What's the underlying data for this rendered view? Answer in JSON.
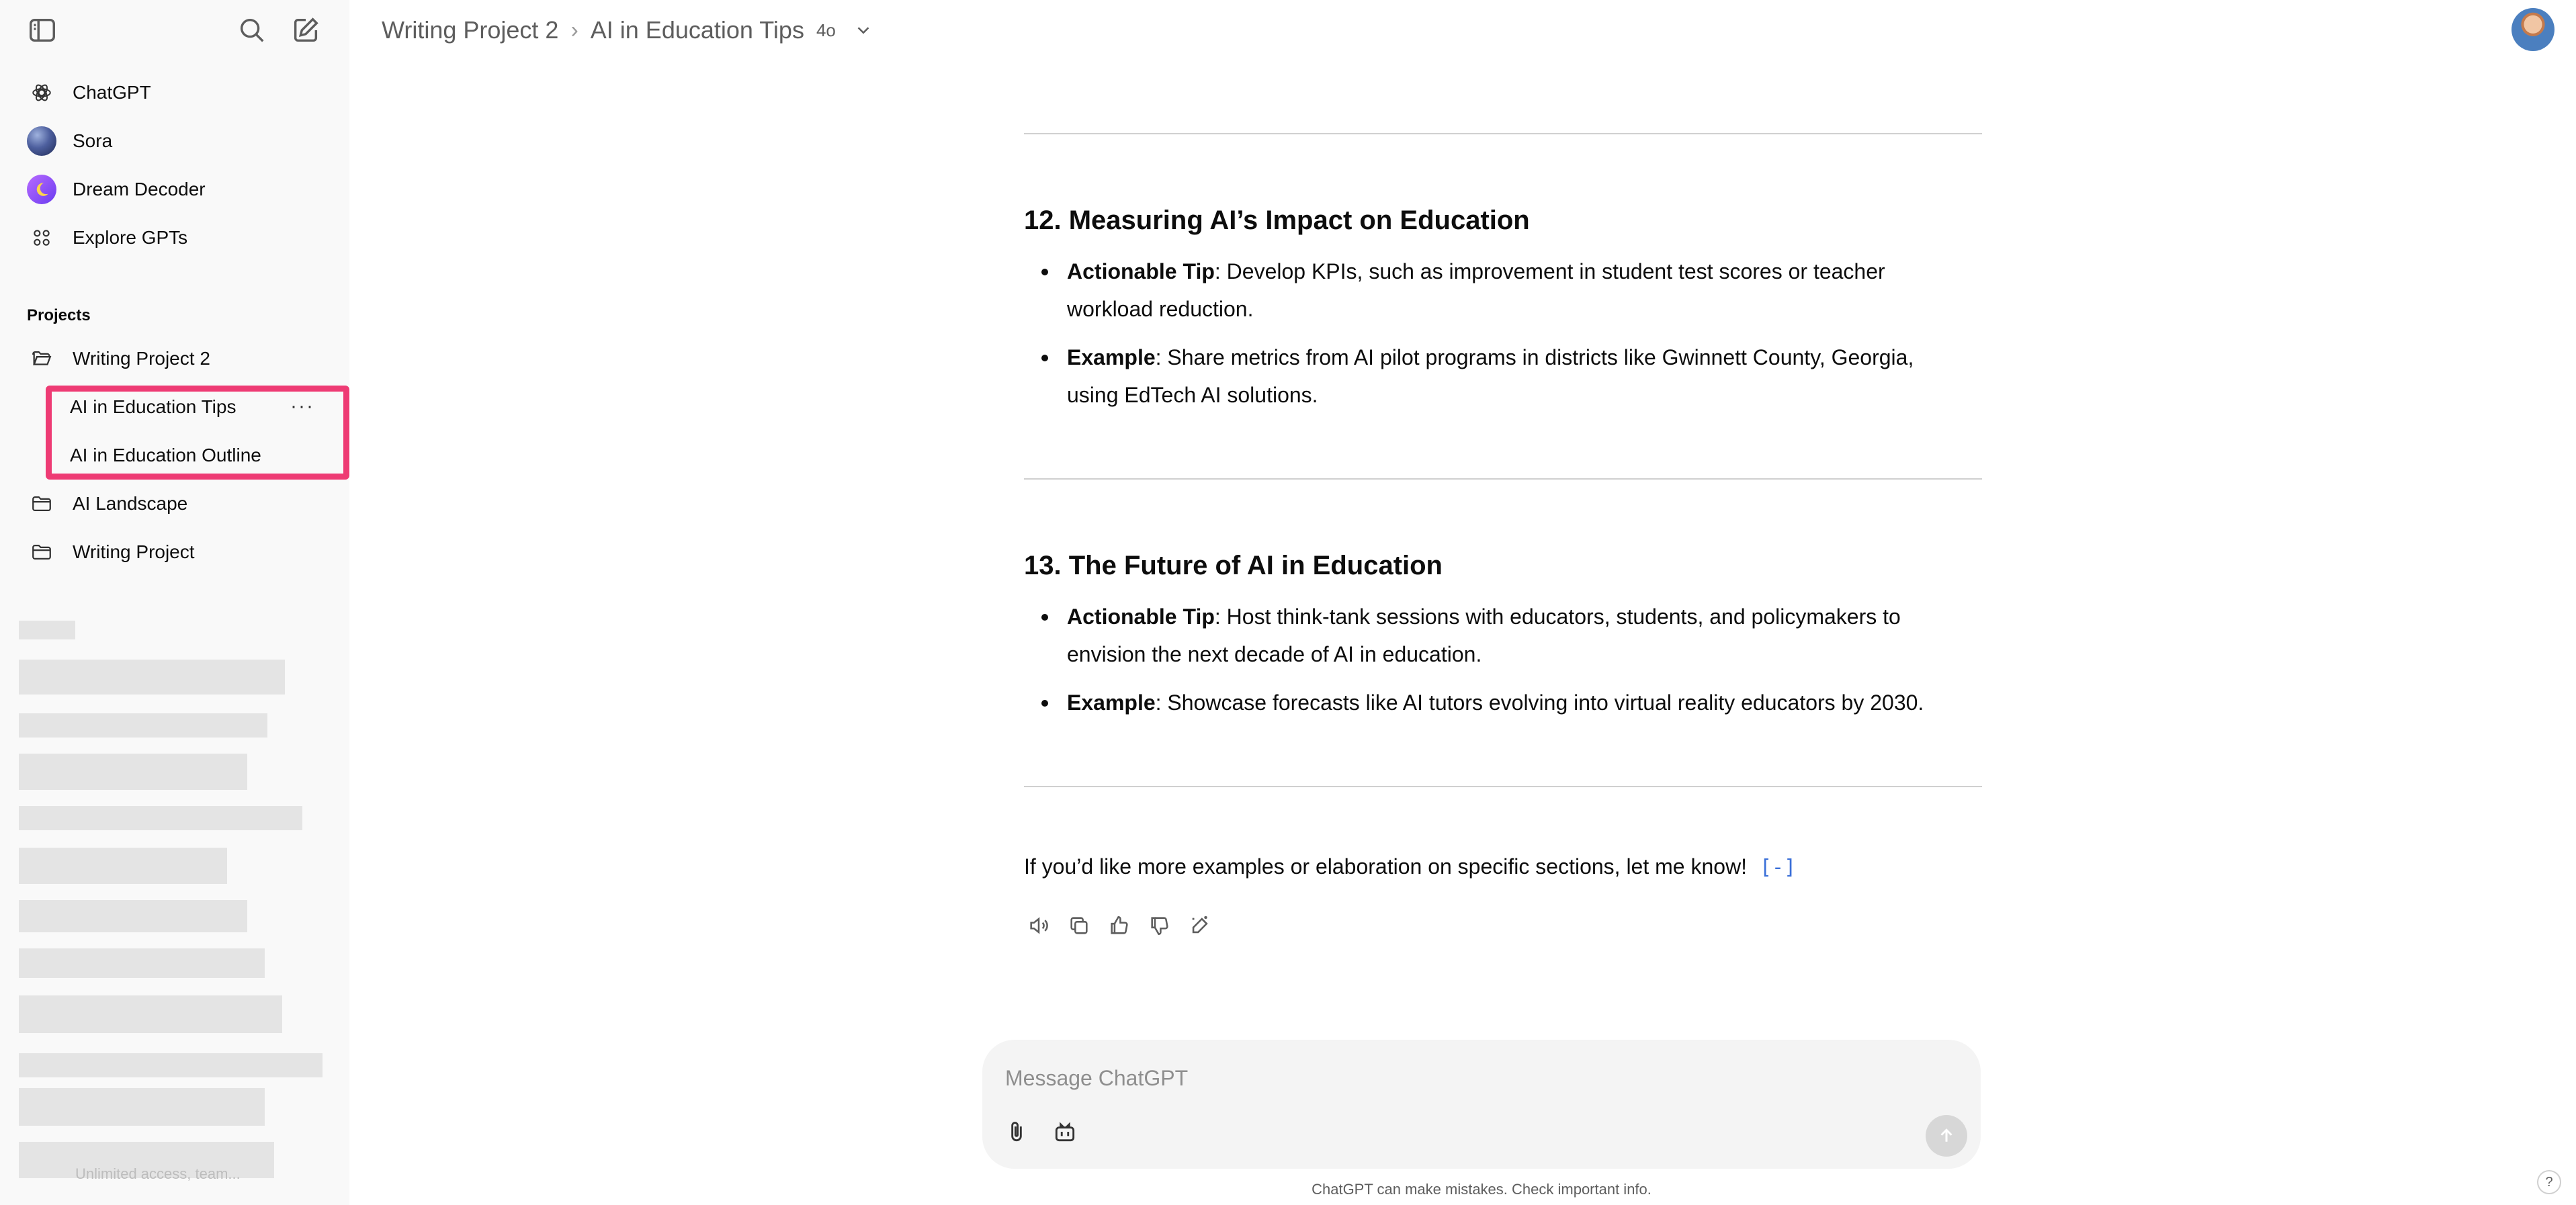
{
  "header": {
    "project": "Writing Project 2",
    "chat_title": "AI in Education Tips",
    "model": "4o"
  },
  "sidebar": {
    "nav": [
      {
        "label": "ChatGPT",
        "icon": "openai-logo-icon"
      },
      {
        "label": "Sora",
        "icon": "sora-icon"
      },
      {
        "label": "Dream Decoder",
        "icon": "dream-decoder-icon"
      },
      {
        "label": "Explore GPTs",
        "icon": "grid-icon"
      }
    ],
    "projects_label": "Projects",
    "projects": [
      {
        "label": "Writing Project 2",
        "icon": "folder-open-icon"
      },
      {
        "label": "AI Landscape",
        "icon": "folder-icon"
      },
      {
        "label": "Writing Project",
        "icon": "folder-icon"
      }
    ],
    "project_chats": [
      {
        "label": "AI in Education Tips",
        "more": "···"
      },
      {
        "label": "AI in Education Outline"
      }
    ],
    "footer_text": "Unlimited access, team..."
  },
  "content": {
    "sections": [
      {
        "title": "12. Measuring AI’s Impact on Education",
        "bullets": [
          {
            "label": "Actionable Tip",
            "text": ": Develop KPIs, such as improvement in student test scores or teacher workload reduction."
          },
          {
            "label": "Example",
            "text": ": Share metrics from AI pilot programs in districts like Gwinnett County, Georgia, using EdTech AI solutions."
          }
        ]
      },
      {
        "title": "13. The Future of AI in Education",
        "bullets": [
          {
            "label": "Actionable Tip",
            "text": ": Host think-tank sessions with educators, students, and policymakers to envision the next decade of AI in education."
          },
          {
            "label": "Example",
            "text": ": Showcase forecasts like AI tutors evolving into virtual reality educators by 2030."
          }
        ]
      }
    ],
    "closing": "If you’d like more examples or elaboration on specific sections, let me know!",
    "citation": "[-]"
  },
  "composer": {
    "placeholder": "Message ChatGPT",
    "value": ""
  },
  "disclaimer": "ChatGPT can make mistakes. Check important info.",
  "help": "?",
  "colors": {
    "highlight": "#ee3b74",
    "sidebar_bg": "#f9f9f9",
    "link": "#3a6fd8"
  }
}
